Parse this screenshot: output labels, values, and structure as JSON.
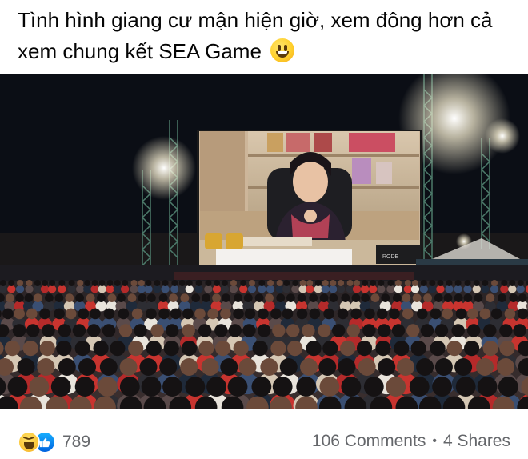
{
  "post": {
    "text": "Tình hình giang cư mận hiện giờ, xem đông hơn cả xem chung kết SEA Game",
    "emoji_icon": "grinning-face-emoji"
  },
  "photo": {
    "description_icon": "photo"
  },
  "footer": {
    "reaction_icons": [
      "haha-reaction-icon",
      "like-reaction-icon"
    ],
    "reaction_count": "789",
    "comments": "106 Comments",
    "separator": "•",
    "shares": "4 Shares"
  },
  "colors": {
    "text": "#050505",
    "secondary_text": "#65676b",
    "like_blue": "#1877f2",
    "haha_yellow": "#fcc83a"
  }
}
